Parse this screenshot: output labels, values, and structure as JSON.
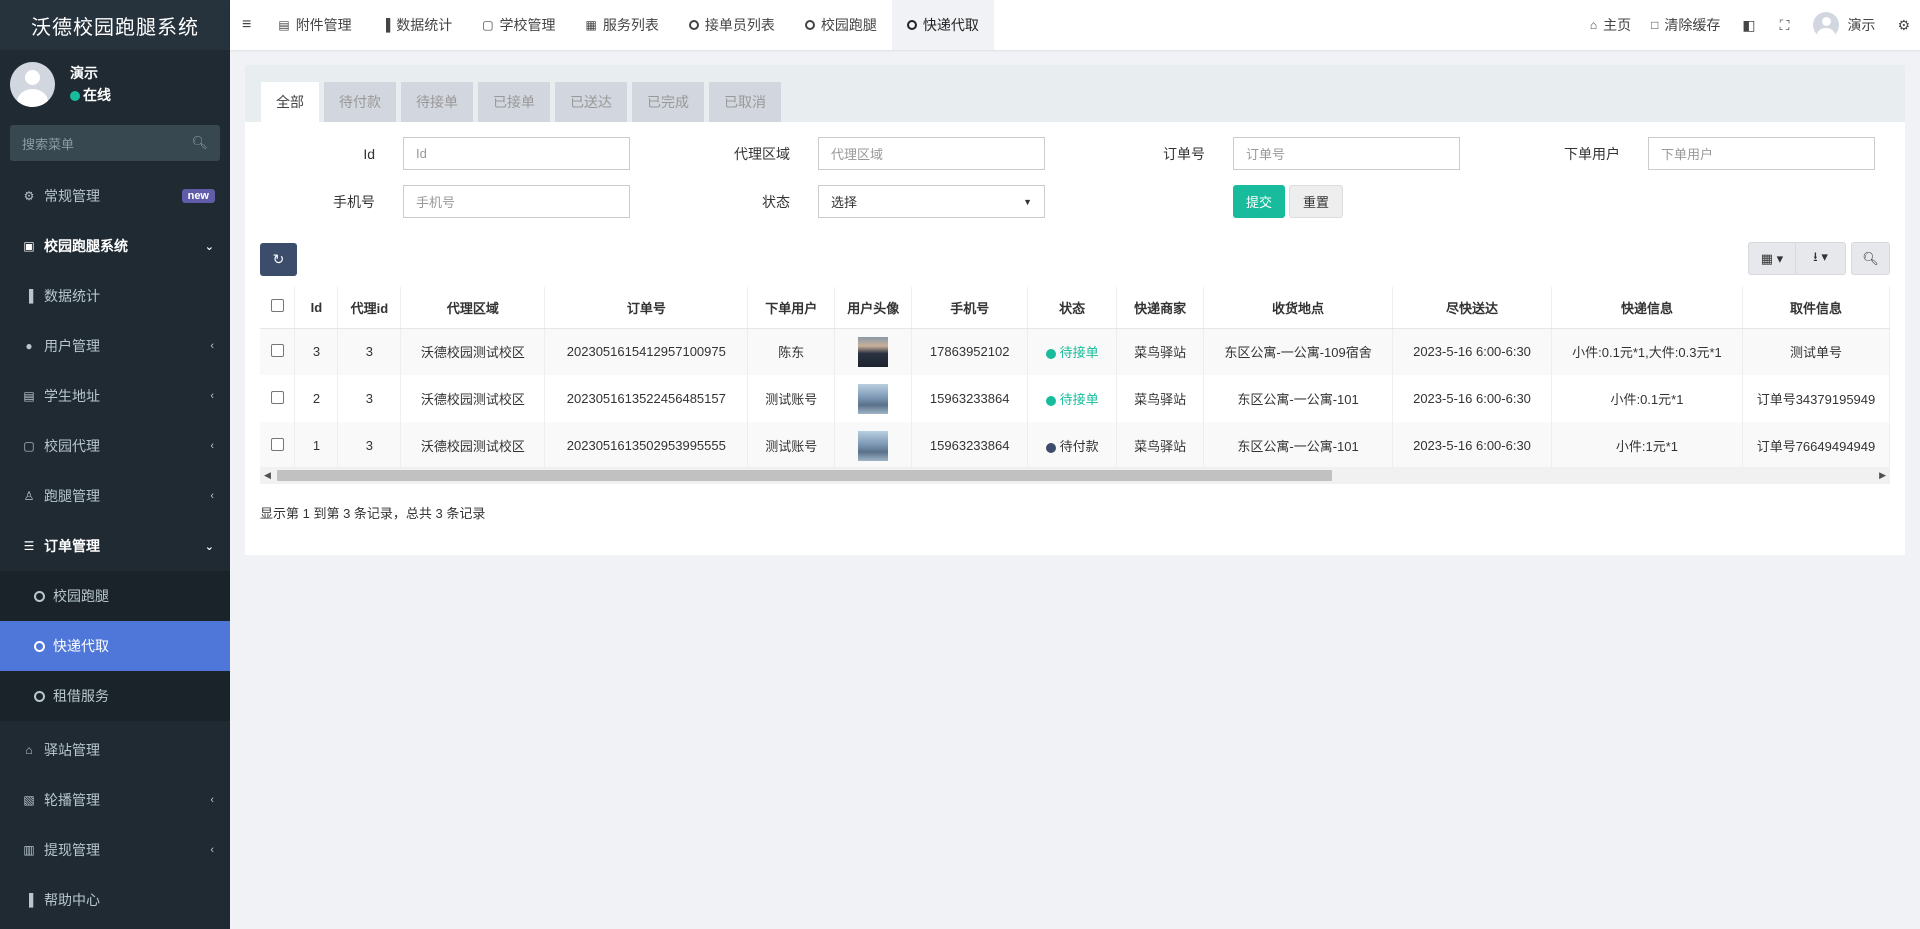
{
  "app": {
    "title": "沃德校园跑腿系统"
  },
  "user": {
    "name": "演示",
    "status": "在线"
  },
  "sidebar": {
    "search_placeholder": "搜索菜单",
    "items": [
      {
        "label": "常规管理",
        "badge": "new"
      },
      {
        "label": "校园跑腿系统"
      },
      {
        "label": "数据统计"
      },
      {
        "label": "用户管理"
      },
      {
        "label": "学生地址"
      },
      {
        "label": "校园代理"
      },
      {
        "label": "跑腿管理"
      },
      {
        "label": "订单管理"
      },
      {
        "label": "校园跑腿"
      },
      {
        "label": "快递代取"
      },
      {
        "label": "租借服务"
      },
      {
        "label": "驿站管理"
      },
      {
        "label": "轮播管理"
      },
      {
        "label": "提现管理"
      },
      {
        "label": "帮助中心"
      }
    ]
  },
  "topbar": {
    "tabs": [
      "附件管理",
      "数据统计",
      "学校管理",
      "服务列表",
      "接单员列表",
      "校园跑腿",
      "快递代取"
    ],
    "home": "主页",
    "clear_cache": "清除缓存",
    "username": "演示"
  },
  "filter_tabs": [
    "全部",
    "待付款",
    "待接单",
    "已接单",
    "已送达",
    "已完成",
    "已取消"
  ],
  "form": {
    "id_label": "Id",
    "id_placeholder": "Id",
    "region_label": "代理区域",
    "region_placeholder": "代理区域",
    "order_label": "订单号",
    "order_placeholder": "订单号",
    "user_label": "下单用户",
    "user_placeholder": "下单用户",
    "phone_label": "手机号",
    "phone_placeholder": "手机号",
    "status_label": "状态",
    "status_value": "选择",
    "submit": "提交",
    "reset": "重置"
  },
  "table": {
    "headers": [
      "Id",
      "代理id",
      "代理区域",
      "订单号",
      "下单用户",
      "用户头像",
      "手机号",
      "状态",
      "快递商家",
      "收货地点",
      "尽快送达",
      "快递信息",
      "取件信息"
    ],
    "rows": [
      {
        "id": "3",
        "agent_id": "3",
        "region": "沃德校园测试校区",
        "order_no": "2023051615412957100975",
        "user": "陈东",
        "phone": "17863952102",
        "status": "待接单",
        "status_color": "#18bc9c",
        "merchant": "菜鸟驿站",
        "address": "东区公寓-一公寓-109宿舍",
        "delivery": "2023-5-16 6:00-6:30",
        "express_info": "小件:0.1元*1,大件:0.3元*1",
        "pickup_info": "测试单号"
      },
      {
        "id": "2",
        "agent_id": "3",
        "region": "沃德校园测试校区",
        "order_no": "2023051613522456485157",
        "user": "测试账号",
        "phone": "15963233864",
        "status": "待接单",
        "status_color": "#18bc9c",
        "merchant": "菜鸟驿站",
        "address": "东区公寓-一公寓-101",
        "delivery": "2023-5-16 6:00-6:30",
        "express_info": "小件:0.1元*1",
        "pickup_info": "订单号34379195949"
      },
      {
        "id": "1",
        "agent_id": "3",
        "region": "沃德校园测试校区",
        "order_no": "2023051613502953995555",
        "user": "测试账号",
        "phone": "15963233864",
        "status": "待付款",
        "status_color": "#3c4c6b",
        "merchant": "菜鸟驿站",
        "address": "东区公寓-一公寓-101",
        "delivery": "2023-5-16 6:00-6:30",
        "express_info": "小件:1元*1",
        "pickup_info": "订单号76649494949"
      }
    ]
  },
  "pagination": {
    "info": "显示第 1 到第 3 条记录，总共 3 条记录"
  }
}
